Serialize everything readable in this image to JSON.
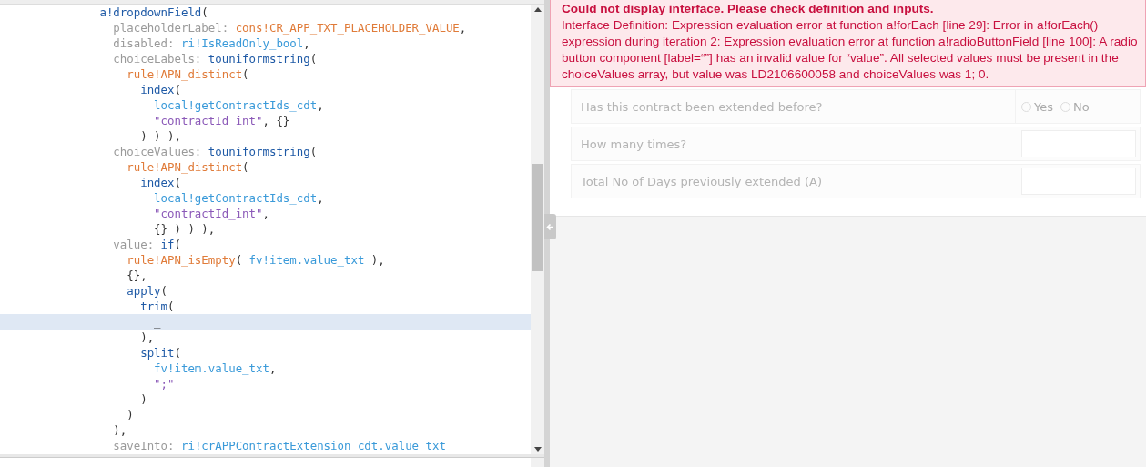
{
  "editor": {
    "lines": [
      {
        "active": false,
        "tokens": [
          {
            "kind": "fn",
            "text": "              a!dropdownField"
          },
          {
            "kind": "punct",
            "text": "("
          }
        ]
      },
      {
        "active": false,
        "tokens": [
          {
            "kind": "key",
            "text": "                placeholderLabel:"
          },
          {
            "kind": "rule",
            "text": " cons!CR_APP_TXT_PLACEHOLDER_VALUE"
          },
          {
            "kind": "punct",
            "text": ","
          }
        ]
      },
      {
        "active": false,
        "tokens": [
          {
            "kind": "key",
            "text": "                disabled:"
          },
          {
            "kind": "var",
            "text": " ri!IsReadOnly_bool"
          },
          {
            "kind": "punct",
            "text": ","
          }
        ]
      },
      {
        "active": false,
        "tokens": [
          {
            "kind": "key",
            "text": "                choiceLabels:"
          },
          {
            "kind": "fn",
            "text": " touniformstring"
          },
          {
            "kind": "punct",
            "text": "("
          }
        ]
      },
      {
        "active": false,
        "tokens": [
          {
            "kind": "rule",
            "text": "                  rule!APN_distinct"
          },
          {
            "kind": "punct",
            "text": "("
          }
        ]
      },
      {
        "active": false,
        "tokens": [
          {
            "kind": "fn",
            "text": "                    index"
          },
          {
            "kind": "punct",
            "text": "("
          }
        ]
      },
      {
        "active": false,
        "tokens": [
          {
            "kind": "var",
            "text": "                      local!getContractIds_cdt"
          },
          {
            "kind": "punct",
            "text": ","
          }
        ]
      },
      {
        "active": false,
        "tokens": [
          {
            "kind": "str",
            "text": "                      \"contractId_int\""
          },
          {
            "kind": "punct",
            "text": ", {}"
          }
        ]
      },
      {
        "active": false,
        "tokens": [
          {
            "kind": "punct",
            "text": "                    ) ) ),"
          }
        ]
      },
      {
        "active": false,
        "tokens": [
          {
            "kind": "key",
            "text": "                choiceValues:"
          },
          {
            "kind": "fn",
            "text": " touniformstring"
          },
          {
            "kind": "punct",
            "text": "("
          }
        ]
      },
      {
        "active": false,
        "tokens": [
          {
            "kind": "rule",
            "text": "                  rule!APN_distinct"
          },
          {
            "kind": "punct",
            "text": "("
          }
        ]
      },
      {
        "active": false,
        "tokens": [
          {
            "kind": "fn",
            "text": "                    index"
          },
          {
            "kind": "punct",
            "text": "("
          }
        ]
      },
      {
        "active": false,
        "tokens": [
          {
            "kind": "var",
            "text": "                      local!getContractIds_cdt"
          },
          {
            "kind": "punct",
            "text": ","
          }
        ]
      },
      {
        "active": false,
        "tokens": [
          {
            "kind": "str",
            "text": "                      \"contractId_int\""
          },
          {
            "kind": "punct",
            "text": ","
          }
        ]
      },
      {
        "active": false,
        "tokens": [
          {
            "kind": "punct",
            "text": "                      {} ) ) ),"
          }
        ]
      },
      {
        "active": false,
        "tokens": [
          {
            "kind": "key",
            "text": "                value:"
          },
          {
            "kind": "fn",
            "text": " if"
          },
          {
            "kind": "punct",
            "text": "("
          }
        ]
      },
      {
        "active": false,
        "tokens": [
          {
            "kind": "rule",
            "text": "                  rule!APN_isEmpty"
          },
          {
            "kind": "punct",
            "text": "( "
          },
          {
            "kind": "var",
            "text": "fv!item.value_txt"
          },
          {
            "kind": "punct",
            "text": " ),"
          }
        ]
      },
      {
        "active": false,
        "tokens": [
          {
            "kind": "punct",
            "text": "                  {},"
          }
        ]
      },
      {
        "active": false,
        "tokens": [
          {
            "kind": "fn",
            "text": "                  apply"
          },
          {
            "kind": "punct",
            "text": "("
          }
        ]
      },
      {
        "active": false,
        "tokens": [
          {
            "kind": "fn",
            "text": "                    trim"
          },
          {
            "kind": "punct",
            "text": "("
          }
        ]
      },
      {
        "active": true,
        "tokens": [
          {
            "kind": "punct",
            "text": "                      _"
          }
        ]
      },
      {
        "active": false,
        "tokens": [
          {
            "kind": "punct",
            "text": "                    ),"
          }
        ]
      },
      {
        "active": false,
        "tokens": [
          {
            "kind": "fn",
            "text": "                    split"
          },
          {
            "kind": "punct",
            "text": "("
          }
        ]
      },
      {
        "active": false,
        "tokens": [
          {
            "kind": "var",
            "text": "                      fv!item.value_txt"
          },
          {
            "kind": "punct",
            "text": ","
          }
        ]
      },
      {
        "active": false,
        "tokens": [
          {
            "kind": "str",
            "text": "                      \";\""
          }
        ]
      },
      {
        "active": false,
        "tokens": [
          {
            "kind": "punct",
            "text": "                    )"
          }
        ]
      },
      {
        "active": false,
        "tokens": [
          {
            "kind": "punct",
            "text": "                  )"
          }
        ]
      },
      {
        "active": false,
        "tokens": [
          {
            "kind": "punct",
            "text": "                ),"
          }
        ]
      },
      {
        "active": false,
        "tokens": [
          {
            "kind": "key",
            "text": "                saveInto:"
          },
          {
            "kind": "var",
            "text": " ri!crAPPContractExtension_cdt.value_txt"
          }
        ]
      }
    ]
  },
  "error": {
    "title": "Could not display interface. Please check definition and inputs.",
    "message": "Interface Definition: Expression evaluation error at function a!forEach [line 29]: Error in a!forEach() expression during iteration 2: Expression evaluation error at function a!radioButtonField [line 100]: A radio button component [label=“”] has an invalid value for “value”. All selected values must be present in the choiceValues array, but value was LD2106600058 and choiceValues was 1; 0."
  },
  "form": {
    "rows": [
      {
        "kind": "radio",
        "label": "Has this contract been extended before?",
        "options": [
          {
            "label": "Yes",
            "selected": false
          },
          {
            "label": "No",
            "selected": false
          }
        ]
      },
      {
        "kind": "input",
        "label": "How many times?"
      },
      {
        "kind": "input",
        "label": "Total No of Days previously extended (A)"
      }
    ]
  }
}
